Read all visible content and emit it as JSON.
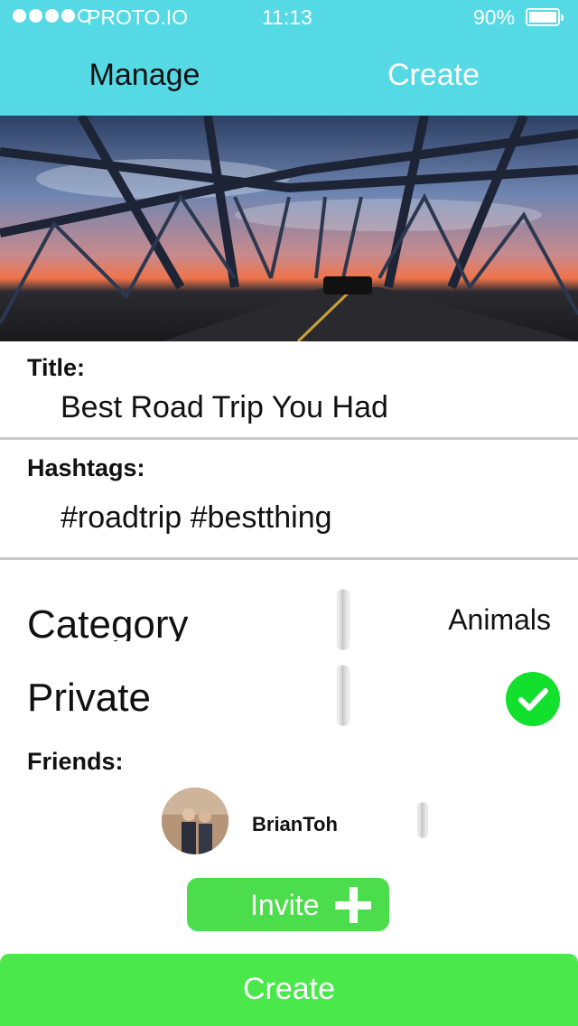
{
  "status_bar": {
    "carrier": "PROTO.IO",
    "time": "11:13",
    "battery": "90%",
    "battery_level": 0.9,
    "signal_bars_filled": 4,
    "signal_bars_total": 5
  },
  "nav": {
    "manage_label": "Manage",
    "create_label": "Create",
    "active": "Create"
  },
  "form": {
    "title_label": "Title:",
    "title_value": "Best Road Trip You Had",
    "hashtags_label": "Hashtags:",
    "hashtags_value": "#roadtrip #bestthing",
    "category_label": "Category",
    "category_value": "Animals",
    "private_label": "Private",
    "private_checked": true,
    "friends_label": "Friends:",
    "friends": [
      {
        "name": "BrianToh"
      }
    ],
    "invite_label": "Invite"
  },
  "footer": {
    "create_label": "Create"
  },
  "colors": {
    "header_bg": "#55d9e4",
    "accent_green": "#4ae84a",
    "check_green": "#12e02c"
  }
}
